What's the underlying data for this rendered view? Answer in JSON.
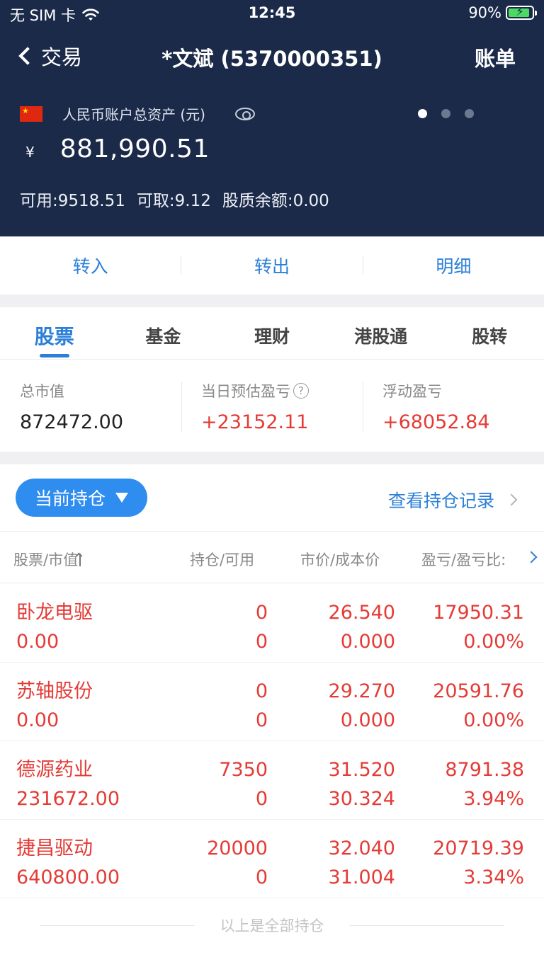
{
  "status_bar": {
    "carrier": "无 SIM 卡",
    "time": "12:45",
    "battery": "90%",
    "battery_level": 0.9
  },
  "nav": {
    "back_label": "交易",
    "title": "*文斌 (5370000351)",
    "right_label": "账单"
  },
  "account": {
    "label": "人民币账户总资产 (元)",
    "currency_symbol": "¥",
    "total": "881,990.51",
    "available": "可用:9518.51",
    "withdrawable": "可取:9.12",
    "pledge": "股质余额:0.00",
    "page_dots": 3,
    "active_dot": 0
  },
  "transfer": {
    "in": "转入",
    "out": "转出",
    "detail": "明细"
  },
  "tabs": [
    "股票",
    "基金",
    "理财",
    "港股通",
    "股转"
  ],
  "summary": {
    "market_value_label": "总市值",
    "market_value": "872472.00",
    "daily_pl_label": "当日预估盈亏",
    "daily_pl": "+23152.11",
    "floating_pl_label": "浮动盈亏",
    "floating_pl": "+68052.84",
    "help_glyph": "?"
  },
  "positions": {
    "filter_label": "当前持仓",
    "record_link": "查看持仓记录",
    "columns": {
      "name": "股票/市值",
      "hold": "持仓/可用",
      "price": "市价/成本价",
      "pl": "盈亏/盈亏比:"
    },
    "rows": [
      {
        "name": "卧龙电驱",
        "value": "0.00",
        "hold": "0",
        "avail": "0",
        "price": "26.540",
        "cost": "0.000",
        "pl": "17950.31",
        "pl_ratio": "0.00%"
      },
      {
        "name": "苏轴股份",
        "value": "0.00",
        "hold": "0",
        "avail": "0",
        "price": "29.270",
        "cost": "0.000",
        "pl": "20591.76",
        "pl_ratio": "0.00%"
      },
      {
        "name": "德源药业",
        "value": "231672.00",
        "hold": "7350",
        "avail": "0",
        "price": "31.520",
        "cost": "30.324",
        "pl": "8791.38",
        "pl_ratio": "3.94%"
      },
      {
        "name": "捷昌驱动",
        "value": "640800.00",
        "hold": "20000",
        "avail": "0",
        "price": "32.040",
        "cost": "31.004",
        "pl": "20719.39",
        "pl_ratio": "3.34%"
      }
    ],
    "footer": "以上是全部持仓"
  },
  "colors": {
    "header_bg": "#1c2a4a",
    "accent": "#2b7fd8",
    "gain": "#e43b36"
  }
}
